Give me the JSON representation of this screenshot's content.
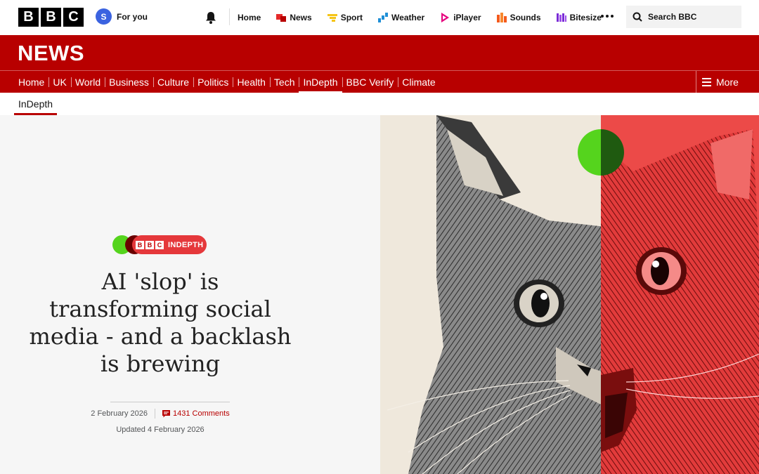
{
  "global_nav": {
    "logo_letters": [
      "B",
      "B",
      "C"
    ],
    "for_you": {
      "avatar_letter": "S",
      "label": "For you"
    },
    "items": [
      {
        "label": "Home",
        "icon": ""
      },
      {
        "label": "News",
        "icon": "news-icon",
        "color": "#e52a2a"
      },
      {
        "label": "Sport",
        "icon": "sport-icon",
        "color": "#f5c518"
      },
      {
        "label": "Weather",
        "icon": "weather-icon",
        "color": "#1f8fd6"
      },
      {
        "label": "iPlayer",
        "icon": "iplayer-icon",
        "color": "#e6007e"
      },
      {
        "label": "Sounds",
        "icon": "sounds-icon",
        "color": "#f45a1c"
      },
      {
        "label": "Bitesize",
        "icon": "bitesize-icon",
        "color": "#7a2bd6"
      }
    ],
    "search_placeholder": "Search BBC"
  },
  "news_banner": {
    "title": "NEWS",
    "color": "#b80000"
  },
  "section_nav": {
    "items": [
      "Home",
      "UK",
      "World",
      "Business",
      "Culture",
      "Politics",
      "Health",
      "Tech",
      "InDepth",
      "BBC Verify",
      "Climate"
    ],
    "active": "InDepth",
    "more_label": "More"
  },
  "sub_nav": {
    "active_tab": "InDepth"
  },
  "article": {
    "badge": {
      "logo_letters": [
        "B",
        "B",
        "C"
      ],
      "label": "INDEPTH"
    },
    "headline": "AI 'slop' is transforming social media - and a backlash is brewing",
    "date": "2 February 2026",
    "comments": "1431 Comments",
    "updated": "Updated 4 February 2026",
    "image_alt_icon": "cat-illustration"
  }
}
